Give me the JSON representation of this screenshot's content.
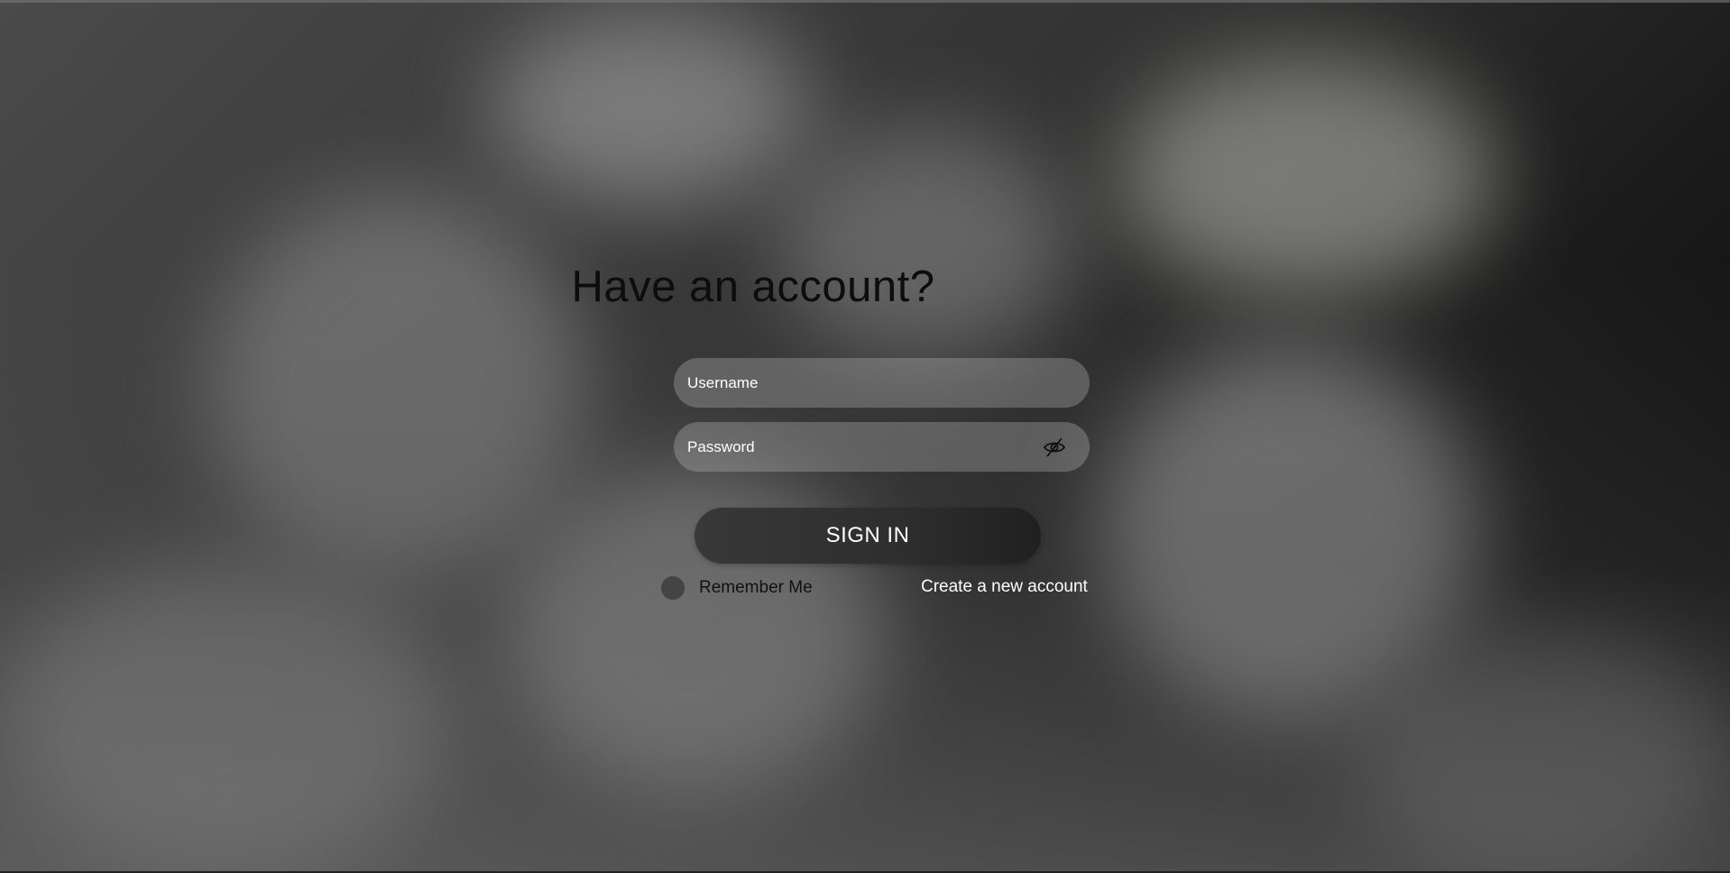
{
  "login": {
    "title": "Have an account?",
    "username_placeholder": "Username",
    "password_placeholder": "Password",
    "password_toggle_icon": "eye-slash-icon",
    "sign_in_label": "SIGN IN",
    "remember_label": "Remember Me",
    "create_account_label": "Create a new account"
  },
  "colors": {
    "button": "#333333",
    "input_fill": "rgba(200,200,200,0.30)",
    "text_light": "#ffffff",
    "text_dark": "#111111"
  }
}
